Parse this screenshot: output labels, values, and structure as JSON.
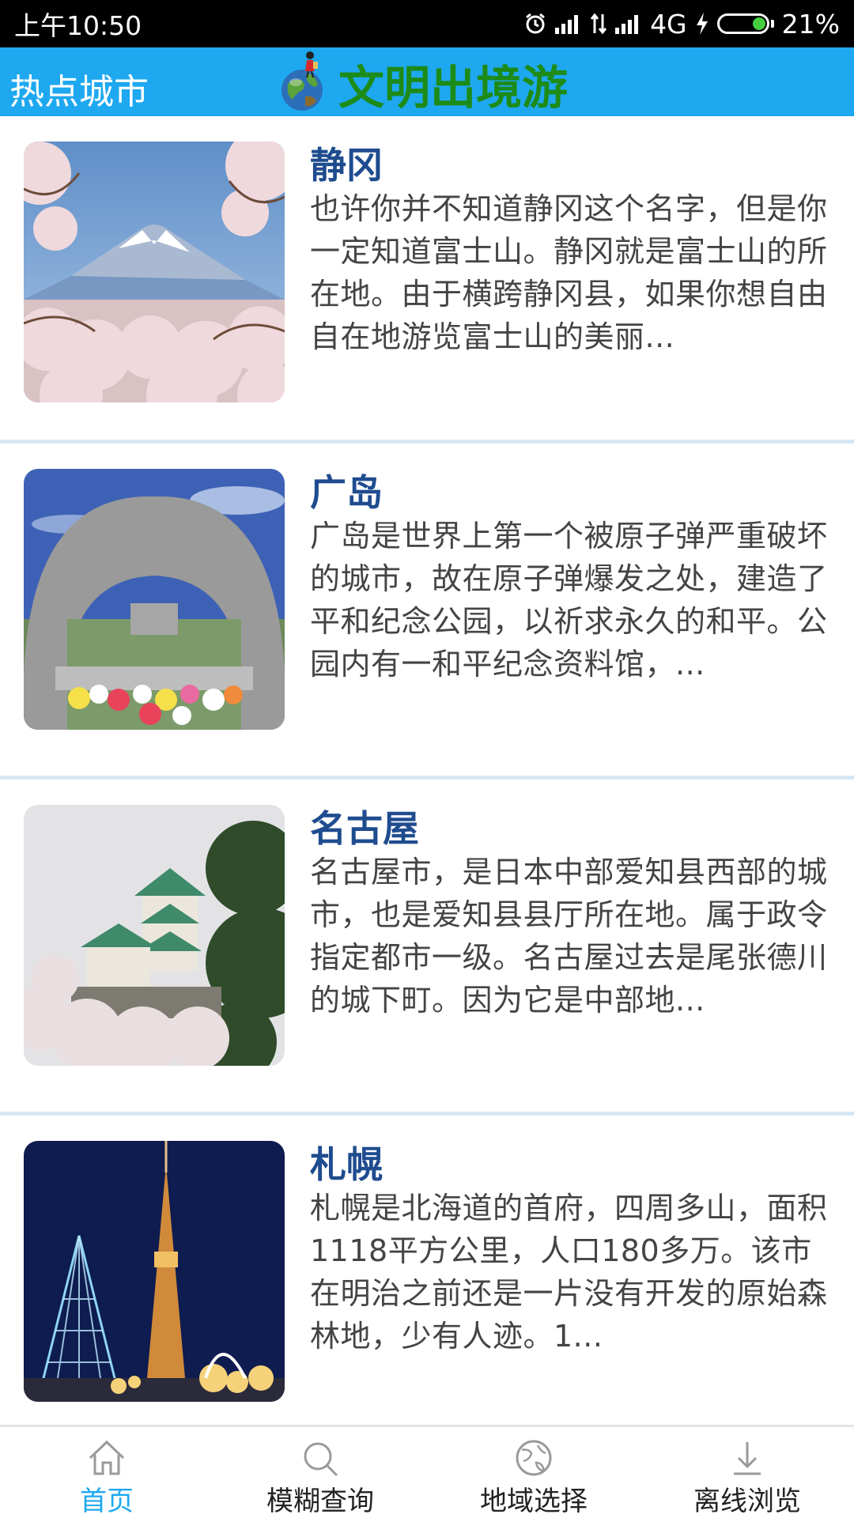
{
  "status_bar": {
    "time": "上午10:50",
    "network": "4G",
    "battery": "21%",
    "battery_level": 0.21
  },
  "header": {
    "title": "热点城市",
    "brand": "文明出境游",
    "logo_icon": "globe-traveler-icon"
  },
  "colors": {
    "header_bg": "#1ea8f0",
    "brand_text": "#1d8b17",
    "title_text": "#1f4c8f",
    "active_tab": "#1ea8f0"
  },
  "cities": [
    {
      "name": "静冈",
      "description": "也许你并不知道静冈这个名字，但是你一定知道富士山。静冈就是富士山的所在地。由于横跨静冈县，如果你想自由自在地游览富士山的美丽...",
      "image": "mount-fuji-cherry-blossom"
    },
    {
      "name": "广岛",
      "description": "广岛是世界上第一个被原子弹严重破坏的城市，故在原子弹爆发之处，建造了平和纪念公园，以祈求永久的和平。公园内有一和平纪念资料馆，...",
      "image": "hiroshima-peace-memorial-arch"
    },
    {
      "name": "名古屋",
      "description": "名古屋市，是日本中部爱知县西部的城市，也是爱知县县厅所在地。属于政令指定都市一级。名古屋过去是尾张德川的城下町。因为它是中部地...",
      "image": "nagoya-castle"
    },
    {
      "name": "札幌",
      "description": "札幌是北海道的首府，四周多山，面积1118平方公里，人口180多万。该市在明治之前还是一片没有开发的原始森林地，少有人迹。1...",
      "image": "sapporo-tv-tower-night"
    }
  ],
  "bottom_nav": [
    {
      "label": "首页",
      "icon": "home-icon",
      "active": true
    },
    {
      "label": "模糊查询",
      "icon": "search-icon",
      "active": false
    },
    {
      "label": "地域选择",
      "icon": "globe-icon",
      "active": false
    },
    {
      "label": "离线浏览",
      "icon": "download-icon",
      "active": false
    }
  ]
}
